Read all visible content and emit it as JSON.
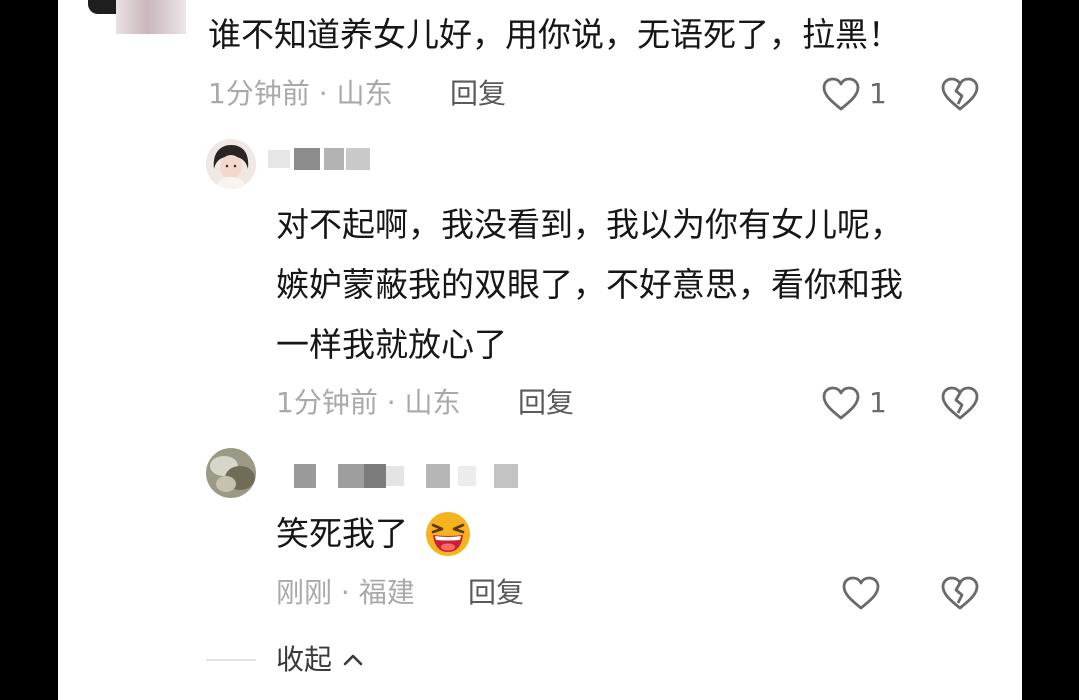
{
  "comments": [
    {
      "text": "谁不知道养女儿好，用你说，无语死了，拉黑！",
      "time": "1分钟前",
      "separator": "·",
      "location": "山东",
      "reply_label": "回复",
      "likes": "1"
    },
    {
      "lines": [
        "对不起啊，我没看到，我以为你有女儿呢，",
        "嫉妒蒙蔽我的双眼了，不好意思，看你和我",
        "一样我就放心了"
      ],
      "time": "1分钟前",
      "separator": "·",
      "location": "山东",
      "reply_label": "回复",
      "likes": "1"
    },
    {
      "text": "笑死我了",
      "emoji": "laughing-face",
      "time": "刚刚",
      "separator": "·",
      "location": "福建",
      "reply_label": "回复"
    }
  ],
  "collapse_label": "收起",
  "colors": {
    "text": "#161616",
    "meta": "#a9a9a9",
    "reply": "#5a5a5a",
    "icon": "#6a6a6a",
    "emoji_face": "#f7b21f",
    "emoji_mouth": "#c8232f"
  }
}
